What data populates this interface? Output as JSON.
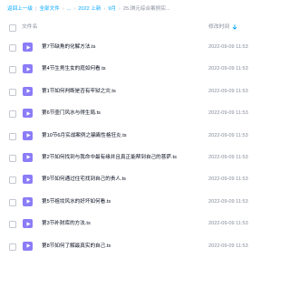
{
  "breadcrumb": {
    "back": "返回上一级",
    "items": [
      "全部文件",
      "...",
      "2022 上新",
      "9月",
      "25.琪元综合案例实..."
    ]
  },
  "header": {
    "name_col": "文件名",
    "time_col": "修改时间",
    "sort_icon": "sort-down-arrow-icon"
  },
  "colors": {
    "accent": "#06a7ff",
    "video_icon": "#8b7cf7",
    "text": "#03081a",
    "muted": "#878c9c"
  },
  "files": [
    {
      "name": "第7节缺角的化解方法.ts",
      "time": "2022-09-09 11:53"
    },
    {
      "name": "第4节生男生女的庭如何看.ts",
      "time": "2022-09-09 11:53"
    },
    {
      "name": "第1节如何判断是否有牢狱之灾.ts",
      "time": "2022-09-09 11:53"
    },
    {
      "name": "第6节壶门风水与得生局.ts",
      "time": "2022-09-09 11:53"
    },
    {
      "name": "第10节6月实战案例之骗离性格狂炎.ts",
      "time": "2022-09-09 11:53"
    },
    {
      "name": "第2节如何找到与我命中最有缘并且真正能帮到自己的菩萨.ts",
      "time": "2022-09-09 11:53"
    },
    {
      "name": "第9节如何通过住宅找到自己的贵人.ts",
      "time": "2022-09-09 11:53"
    },
    {
      "name": "第5节祖坟风水的好坏如何看.ts",
      "time": "2022-09-09 11:53"
    },
    {
      "name": "第3节补财库的方法.ts",
      "time": "2022-09-09 11:53"
    },
    {
      "name": "第8节如何了解最真实的自己.ts",
      "time": "2022-09-09 11:53"
    }
  ]
}
